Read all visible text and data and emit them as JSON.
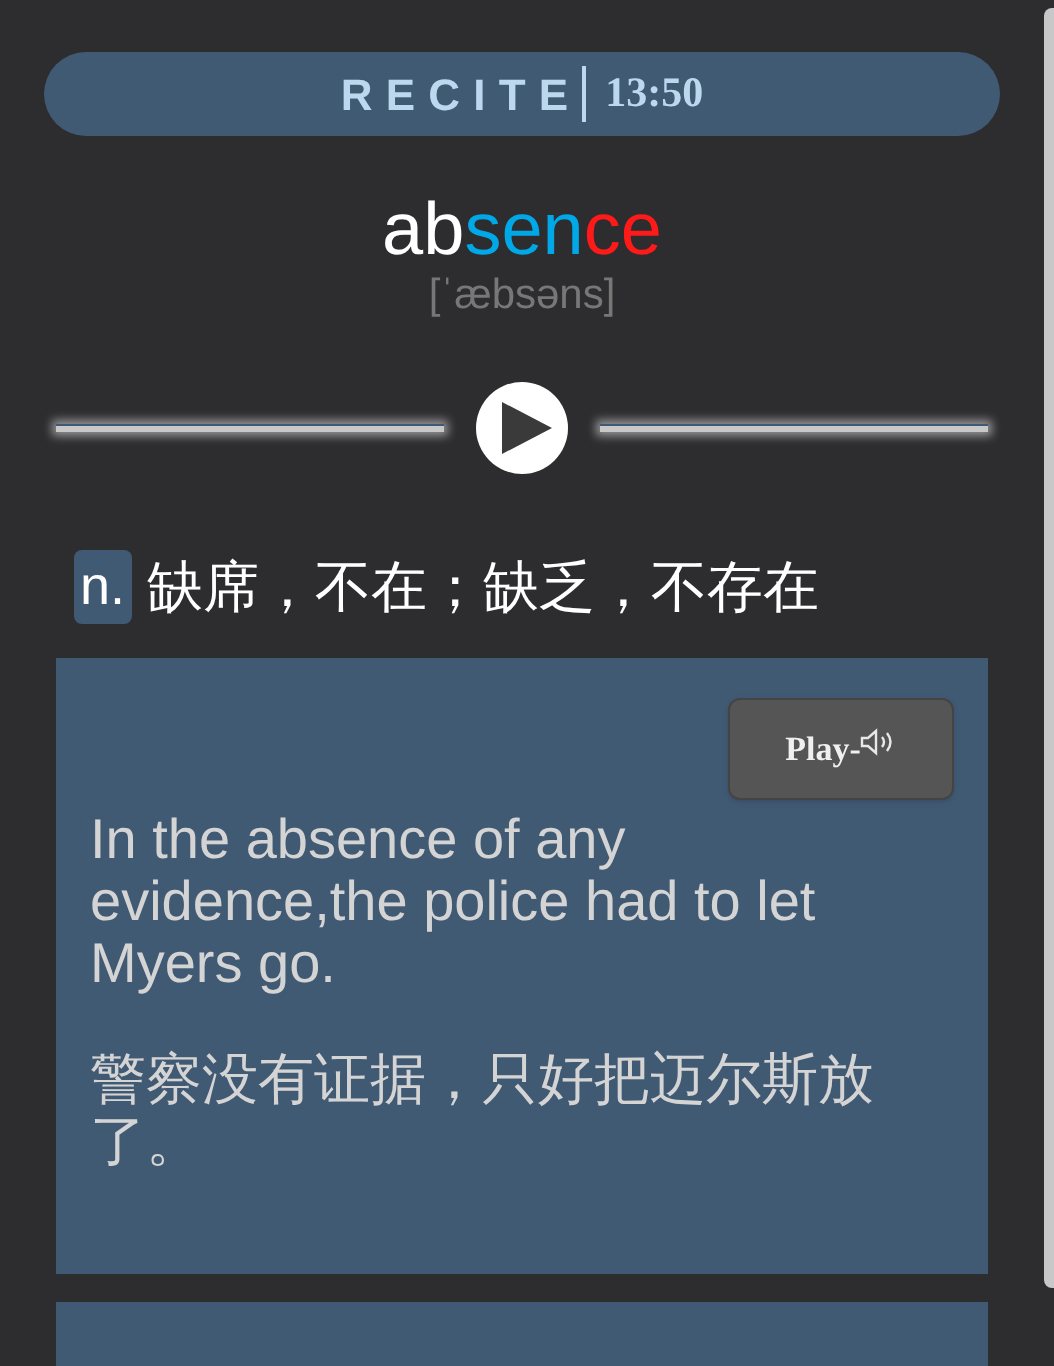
{
  "header": {
    "title": "RECITE",
    "time": "13:50"
  },
  "word": {
    "segments": [
      {
        "text": "ab",
        "color": "#ffffff"
      },
      {
        "text": "sen",
        "color": "#00a8e8"
      },
      {
        "text": "ce",
        "color": "#ff1a1a"
      }
    ],
    "phonetic": "[ˈæbsəns]"
  },
  "definition": {
    "part_of_speech": "n.",
    "meaning": "缺席，不在；缺乏，不存在"
  },
  "examples": [
    {
      "button": "Play-",
      "english": "In the absence of any evidence,the police had to let Myers go.",
      "chinese": "警察没有证据，只好把迈尔斯放了。"
    }
  ]
}
